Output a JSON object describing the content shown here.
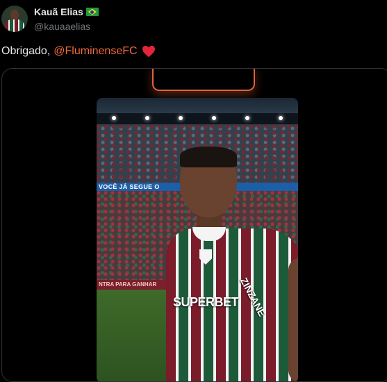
{
  "author": {
    "name": "Kauã Elias",
    "handle": "@kauaaelias",
    "flag_icon": "brazil-flag-icon"
  },
  "tweet": {
    "text": "Obrigado,",
    "mention": "@FluminenseFC",
    "emoji_icon": "red-heart-icon"
  },
  "media": {
    "banner_text": "VOCÊ JÁ SEGUE O",
    "board_text": "NTRA PARA GANHAR",
    "jersey_sponsor": "SUPERBET",
    "sleeve_sponsor": "ZINZANE"
  },
  "colors": {
    "background": "#000000",
    "mention": "#f26a3c",
    "secondary_text": "#71767b",
    "heart": "#e3243b"
  }
}
